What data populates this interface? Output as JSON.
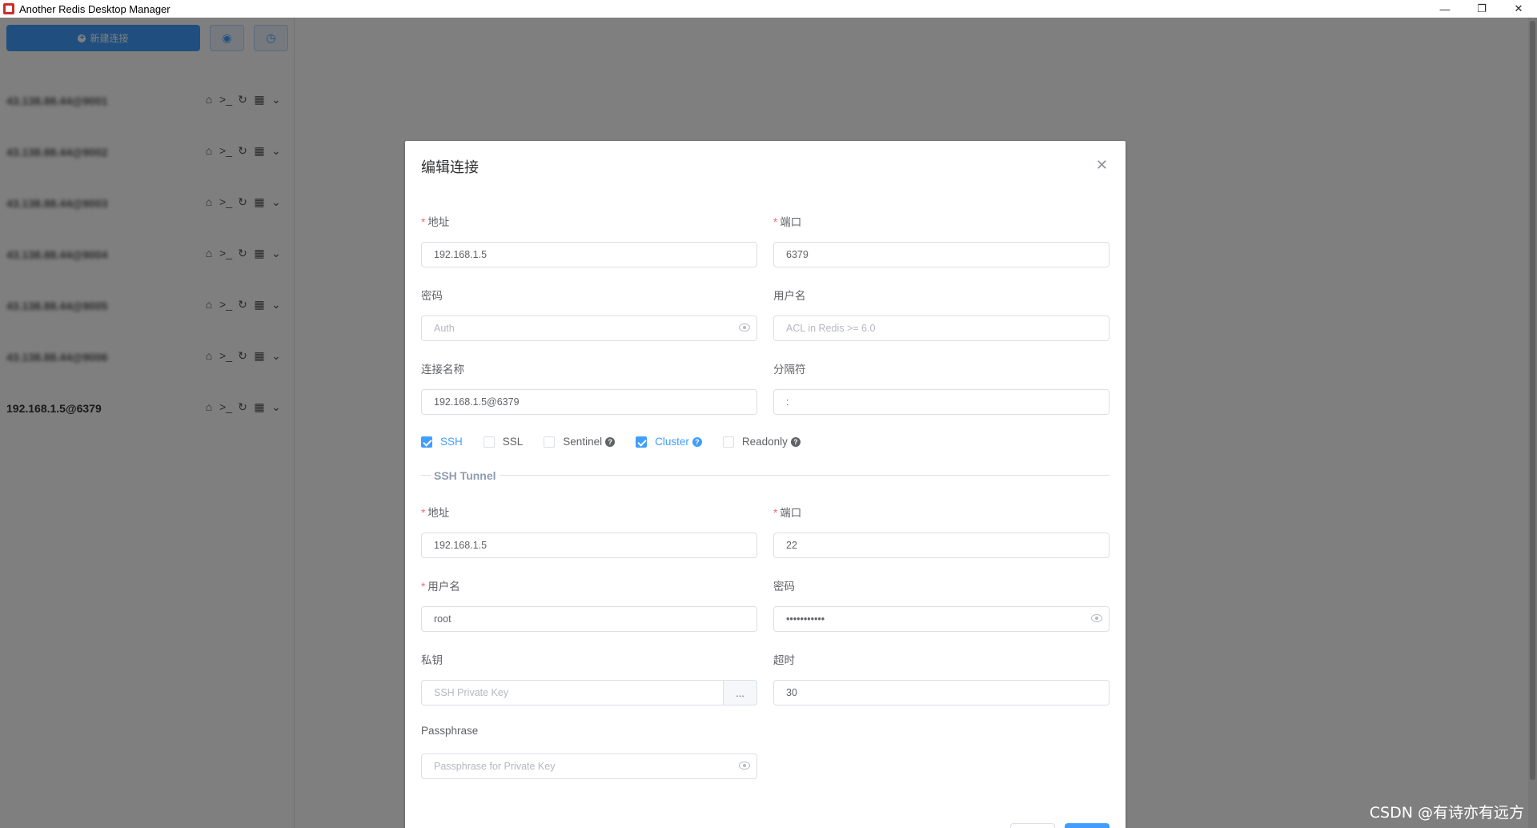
{
  "window": {
    "title": "Another Redis Desktop Manager",
    "controls": [
      "—",
      "❐",
      "✕"
    ]
  },
  "sidebar": {
    "new_connection_label": "新建连接",
    "connections": [
      {
        "name": "43.138.88.44@9001",
        "blurred": true
      },
      {
        "name": "43.138.88.44@9002",
        "blurred": true
      },
      {
        "name": "43.138.88.44@9003",
        "blurred": true
      },
      {
        "name": "43.138.88.44@9004",
        "blurred": true
      },
      {
        "name": "43.138.88.44@9005",
        "blurred": true
      },
      {
        "name": "43.138.88.44@9006",
        "blurred": true
      },
      {
        "name": "192.168.1.5@6379",
        "blurred": false
      }
    ],
    "row_icons": [
      "home-icon",
      "terminal-icon",
      "refresh-icon",
      "grid-icon",
      "chevron-down-icon"
    ]
  },
  "dialog": {
    "title": "编辑连接",
    "host": {
      "label": "地址",
      "value": "192.168.1.5"
    },
    "port": {
      "label": "端口",
      "value": "6379"
    },
    "password": {
      "label": "密码",
      "placeholder": "Auth"
    },
    "username": {
      "label": "用户名",
      "placeholder": "ACL in Redis >= 6.0"
    },
    "conn_name": {
      "label": "连接名称",
      "value": "192.168.1.5@6379"
    },
    "separator": {
      "label": "分隔符",
      "value": ":"
    },
    "options": {
      "ssh": {
        "label": "SSH",
        "checked": true
      },
      "ssl": {
        "label": "SSL",
        "checked": false
      },
      "sentinel": {
        "label": "Sentinel",
        "checked": false
      },
      "cluster": {
        "label": "Cluster",
        "checked": true
      },
      "readonly": {
        "label": "Readonly",
        "checked": false
      }
    },
    "ssh_tunnel": {
      "heading": "SSH Tunnel",
      "host": {
        "label": "地址",
        "value": "192.168.1.5"
      },
      "port": {
        "label": "端口",
        "value": "22"
      },
      "username": {
        "label": "用户名",
        "value": "root"
      },
      "password": {
        "label": "密码",
        "value": "•••••••••••"
      },
      "private_key": {
        "label": "私钥",
        "placeholder": "SSH Private Key",
        "button": "..."
      },
      "timeout": {
        "label": "超时",
        "value": "30"
      },
      "passphrase": {
        "label": "Passphrase",
        "placeholder": "Passphrase for Private Key"
      }
    }
  },
  "watermark": "CSDN @有诗亦有远方",
  "colors": {
    "primary": "#409eff",
    "required": "#f56c6c"
  }
}
